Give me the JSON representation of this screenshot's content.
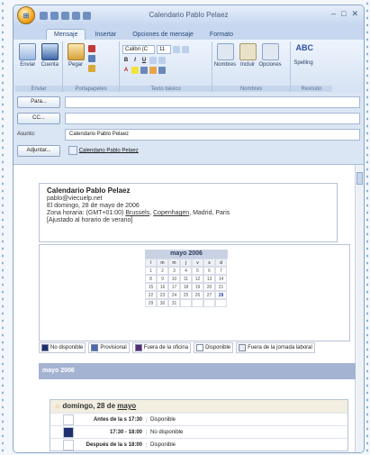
{
  "window": {
    "title": "Calendario Pablo Pelaez"
  },
  "tabs": [
    "Mensaje",
    "Insertar",
    "Opciones de mensaje",
    "Formato"
  ],
  "ribbon": {
    "groups": [
      {
        "label": "Enviar",
        "buttons": [
          "Enviar",
          "Cuenta"
        ]
      },
      {
        "label": "Portapapeles",
        "buttons": [
          "Pegar"
        ]
      },
      {
        "label": "Texto básico",
        "font": "Calibri (C",
        "size": "11"
      },
      {
        "label": "Nombres",
        "buttons": [
          "Nombres",
          "Incluir",
          "Opciones"
        ]
      },
      {
        "label": "Revisión",
        "buttons": [
          "Spelling"
        ]
      }
    ]
  },
  "fields": {
    "to_button": "Para...",
    "cc_button": "CC...",
    "subject_label": "Asunto:",
    "subject_value": "Calendario Pablo Pelaez",
    "attach_button": "Adjuntar...",
    "attach_value": "Calendario Pablo Pelaez"
  },
  "card": {
    "name": "Calendario Pablo Pelaez",
    "email": "pablo@viecuelp.net",
    "date": "El domingo, 28 de mayo de 2006",
    "tz_prefix": "Zona horaria: (GMT+01:00)",
    "tz_link1": "Brussels",
    "tz_link2": "Copenhagen",
    "tz_rest": ", Madrid, Paris",
    "dst": "[Ajustado al horario de verano]"
  },
  "mini_calendar": {
    "title": "mayo 2006",
    "headers": [
      "l",
      "m",
      "m",
      "j",
      "v",
      "s",
      "d"
    ],
    "weeks": [
      [
        "1",
        "2",
        "3",
        "4",
        "5",
        "6",
        "7"
      ],
      [
        "8",
        "9",
        "10",
        "11",
        "12",
        "13",
        "14"
      ],
      [
        "15",
        "16",
        "17",
        "18",
        "19",
        "20",
        "21"
      ],
      [
        "22",
        "23",
        "24",
        "25",
        "26",
        "27",
        "28"
      ],
      [
        "29",
        "30",
        "31",
        "",
        "",
        "",
        ""
      ]
    ],
    "highlight": "28"
  },
  "legend": [
    {
      "label": "No disponible",
      "color": "#1d2f6f"
    },
    {
      "label": "Provisional",
      "color": "#4a6ab0"
    },
    {
      "label": "Fuera de la oficina",
      "color": "#5b2a7a"
    },
    {
      "label": "Disponible",
      "color": "#ffffff"
    },
    {
      "label": "Fuera de la jornada laboral",
      "color": "#e8ecf2"
    }
  ],
  "month_header": "mayo 2006",
  "day": {
    "title": "domingo, 28 de",
    "title_link": "mayo",
    "rows": [
      {
        "time": "Antes de la s 17:30",
        "status": "Disponible",
        "color": "#ffffff"
      },
      {
        "time": "17:30 - 18:00",
        "status": "No disponible",
        "color": "#1d2f6f"
      },
      {
        "time": "Después de la s 18:00",
        "status": "Disponible",
        "color": "#ffffff"
      }
    ]
  },
  "colors": {
    "accent": "#f3a41c",
    "ribbon": "#dbe6f4",
    "month_bar": "#a5b3d3"
  }
}
